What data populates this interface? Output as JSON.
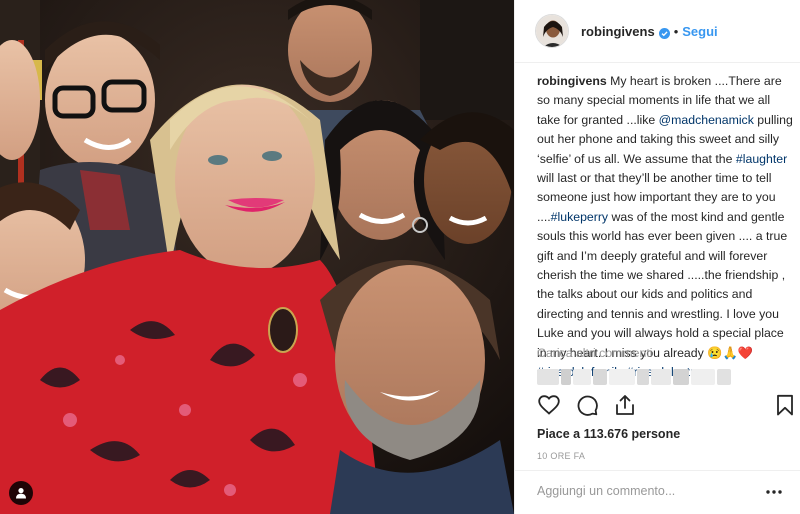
{
  "header": {
    "username": "robingivens",
    "separator": "•",
    "follow_label": "Segui"
  },
  "caption": {
    "username": "robingivens",
    "t1": " My heart is broken ....There are so many special moments in life that we all take for granted ...like ",
    "mention": "@madchenamick",
    "t2": " pulling out her phone and taking this sweet and silly ‘selfie’ of us all. We assume that the ",
    "tag_laughter": "#laughter",
    "t3": " will last or that they’ll be another time to tell someone just how important they are to you ....",
    "tag_lukeperry": "#lukeperry",
    "t4": " was of the most kind and gentle souls this world has ever been given .... a true gift and I’m deeply grateful and will forever cherish the time we shared .....the friendship , the talks about our kids and politics and directing and tennis and wrestling. I love you Luke and you will always hold a special place in my heart. I miss you already 😢🙏❤️",
    "tag_family": "#riverdalefamily",
    "tag_strong": "#riverdalestrong"
  },
  "load_more_label": "Carica altri commenti",
  "icons": {
    "like": "heart-icon",
    "comment": "comment-icon",
    "share": "share-icon",
    "save": "bookmark-icon",
    "more": "more-options-icon",
    "verified": "verified-badge-icon",
    "tag": "user-tag-icon"
  },
  "likes_text": "Piace a 113.676 persone",
  "timestamp": "10 ORE FA",
  "comment_box": {
    "placeholder": "Aggiungi un commento...",
    "value": ""
  },
  "colors": {
    "link": "#003569",
    "follow": "#3897f0",
    "muted": "#999999",
    "verified": "#3897f0",
    "text": "#262626"
  }
}
